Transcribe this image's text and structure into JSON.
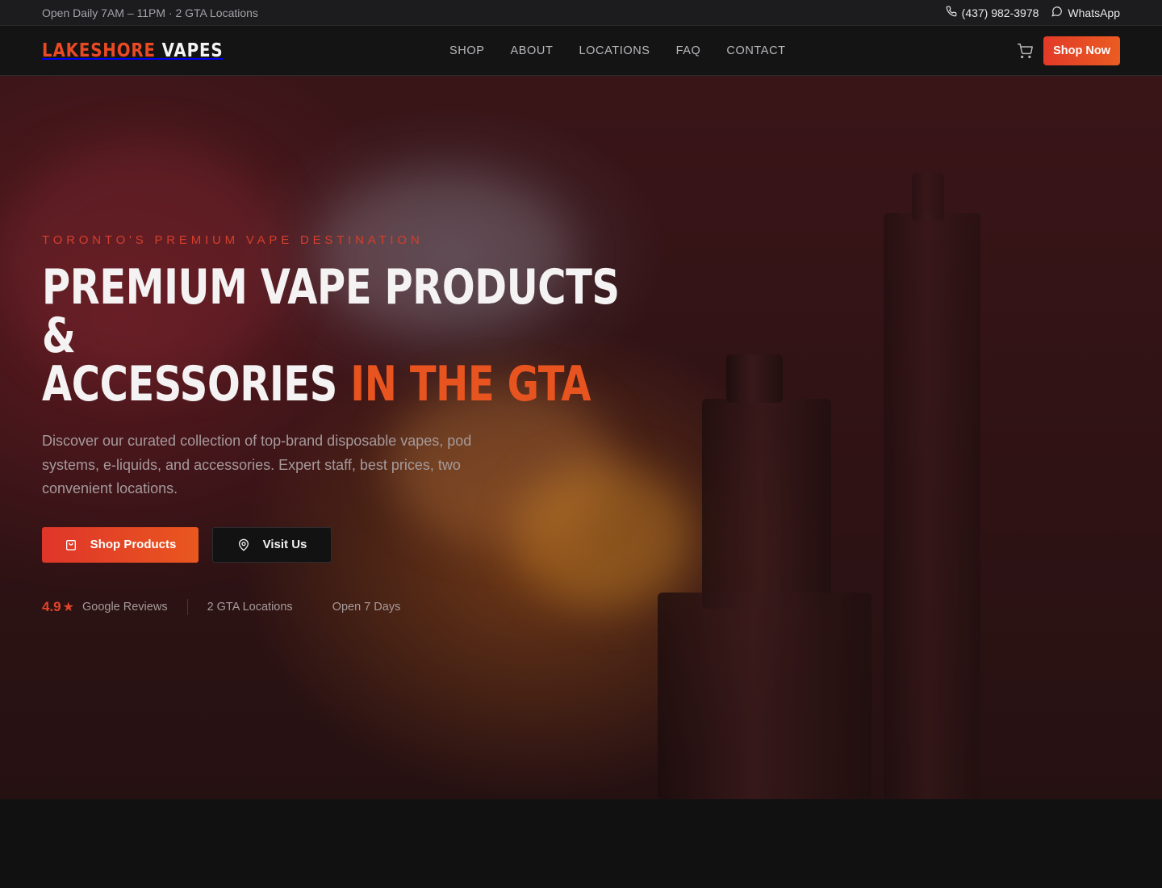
{
  "topbar": {
    "hours": "Open Daily 7AM – 11PM · 2 GTA Locations",
    "phone": "(437) 982-3978",
    "whatsapp": "WhatsApp"
  },
  "header": {
    "logo_part1": "LAKESHORE",
    "logo_part2": "VAPES",
    "nav": [
      "SHOP",
      "ABOUT",
      "LOCATIONS",
      "FAQ",
      "CONTACT"
    ],
    "cta": "Shop Now"
  },
  "hero": {
    "eyebrow": "TORONTO'S PREMIUM VAPE DESTINATION",
    "headline_line1": "PREMIUM VAPE PRODUCTS &",
    "headline_line2_white": "ACCESSORIES",
    "headline_line2_accent": "IN THE GTA",
    "subtext": "Discover our curated collection of top-brand disposable vapes, pod systems, e-liquids, and accessories. Expert staff, best prices, two convenient locations.",
    "primary_button": "Shop Products",
    "secondary_button": "Visit Us",
    "stats": {
      "rating": "4.9",
      "rating_star": "★",
      "rating_label": "Google Reviews",
      "locations": "2 GTA Locations",
      "open": "Open 7 Days"
    }
  },
  "colors": {
    "accent": "#e8541f",
    "accent_red": "#df352a",
    "background": "#111112"
  },
  "icons": {
    "phone": "phone-icon",
    "whatsapp": "chat-bubble-icon",
    "cart": "cart-icon",
    "shop_products": "shopping-bag-icon",
    "visit_us": "map-pin-icon"
  }
}
